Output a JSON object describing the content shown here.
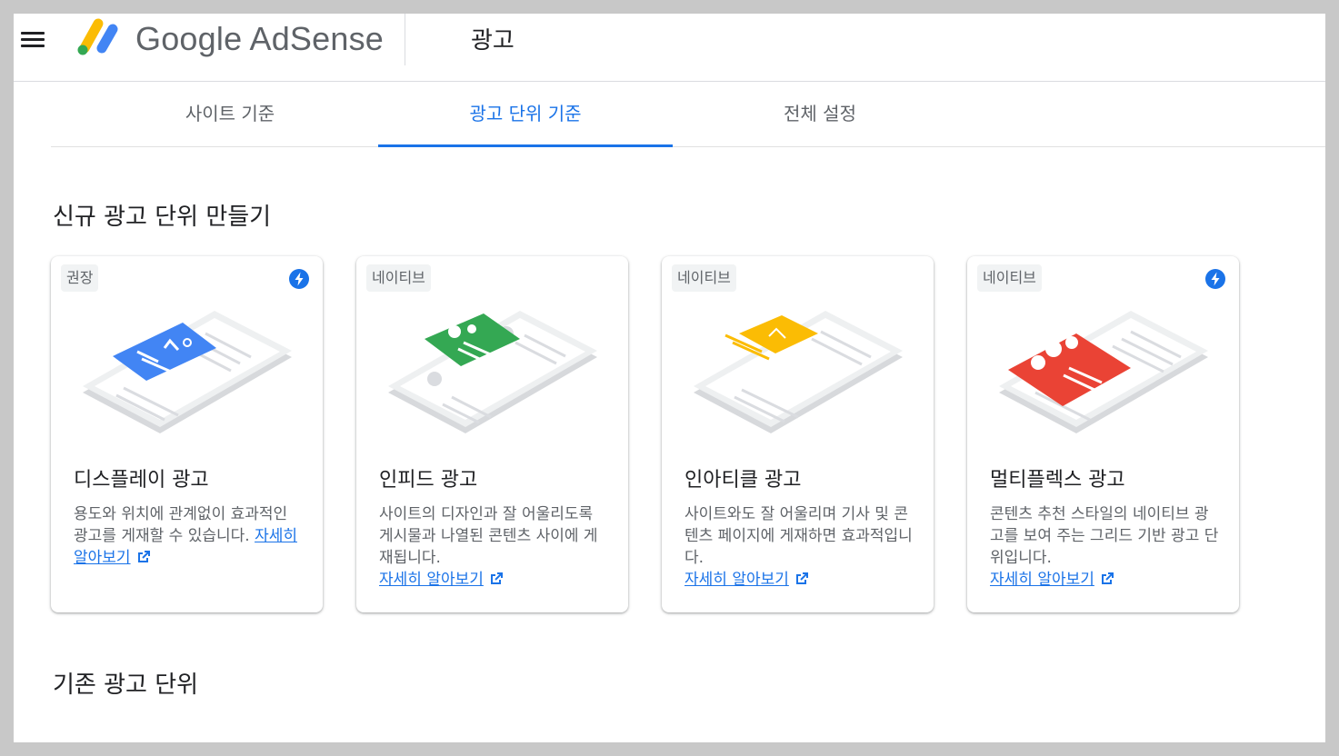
{
  "header": {
    "brand": "Google AdSense",
    "page_title": "광고"
  },
  "tabs": [
    {
      "label": "사이트 기준",
      "active": false
    },
    {
      "label": "광고 단위 기준",
      "active": true
    },
    {
      "label": "전체 설정",
      "active": false
    }
  ],
  "sections": {
    "new_title": "신규 광고 단위 만들기",
    "existing_title": "기존 광고 단위"
  },
  "cards": [
    {
      "badge": "권장",
      "title": "디스플레이 광고",
      "description": "용도와 위치에 관계없이 효과적인 광고를 게재할 수 있습니다.",
      "link": "자세히 알아보기",
      "accent": "#4285f4",
      "bolt": true
    },
    {
      "badge": "네이티브",
      "title": "인피드 광고",
      "description": "사이트의 디자인과 잘 어울리도록 게시물과 나열된 콘텐츠 사이에 게재됩니다.",
      "link": "자세히 알아보기",
      "accent": "#34a853",
      "bolt": false
    },
    {
      "badge": "네이티브",
      "title": "인아티클 광고",
      "description": "사이트와도 잘 어울리며 기사 및 콘텐츠 페이지에 게재하면 효과적입니다.",
      "link": "자세히 알아보기",
      "accent": "#fbbc04",
      "bolt": false
    },
    {
      "badge": "네이티브",
      "title": "멀티플렉스 광고",
      "description": "콘텐츠 추천 스타일의 네이티브 광고를 보여 주는 그리드 기반 광고 단위입니다.",
      "link": "자세히 알아보기",
      "accent": "#ea4335",
      "bolt": true
    }
  ],
  "colors": {
    "link": "#1a73e8",
    "tab_active": "#1a73e8"
  },
  "icons": {
    "menu": "hamburger-menu-icon",
    "bolt": "lightning-bolt-icon",
    "external": "open-in-new-icon"
  }
}
